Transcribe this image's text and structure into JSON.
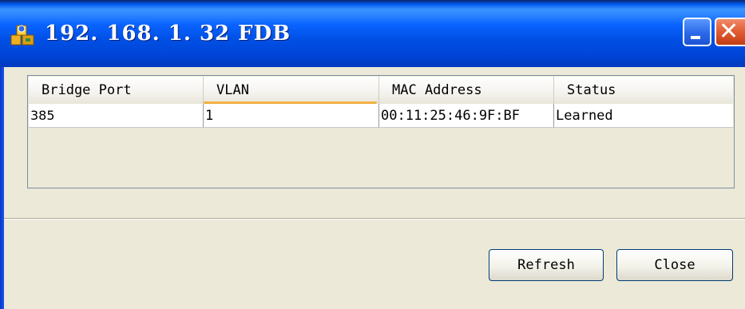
{
  "window": {
    "title": "192. 168. 1. 32  FDB",
    "icon": "network-app-icon"
  },
  "titlebar_buttons": {
    "minimize_icon": "minimize-icon",
    "close_icon": "close-icon",
    "close_glyph": "✕"
  },
  "table": {
    "columns": [
      "Bridge Port",
      "VLAN",
      "MAC Address",
      "Status"
    ],
    "sorted_column": "VLAN",
    "rows": [
      {
        "bridge_port": "385",
        "vlan": "1",
        "mac": "00:11:25:46:9F:BF",
        "status": "Learned"
      }
    ]
  },
  "buttons": {
    "refresh": "Refresh",
    "close": "Close"
  },
  "colors": {
    "titlebar": "#0050e6",
    "window_bg": "#ece9d8",
    "sort_indicator": "#e49a1c",
    "close_button": "#e05a32"
  }
}
